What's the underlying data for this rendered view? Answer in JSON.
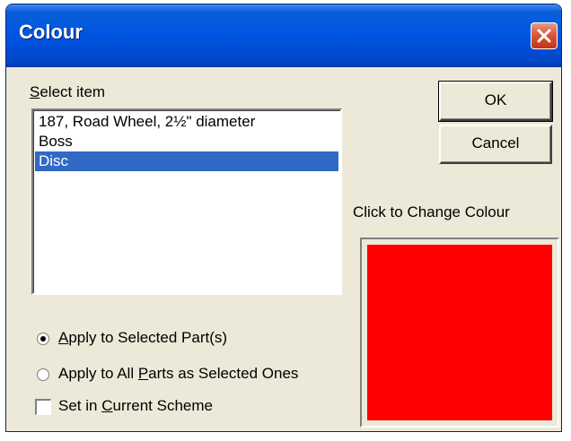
{
  "window": {
    "title": "Colour"
  },
  "select_item": {
    "label_accel": "S",
    "label_rest": "elect item",
    "items": [
      {
        "label": "187, Road Wheel, 2½\" diameter",
        "selected": false
      },
      {
        "label": "Boss",
        "selected": false
      },
      {
        "label": "Disc",
        "selected": true
      }
    ]
  },
  "buttons": {
    "ok": "OK",
    "cancel": "Cancel"
  },
  "colour_panel": {
    "label": "Click to Change Colour",
    "colour": "#ff0000"
  },
  "options": {
    "apply_selected": {
      "pre": "",
      "accel": "A",
      "post": "pply to Selected Part(s)",
      "checked": true
    },
    "apply_all": {
      "pre": "Apply to All ",
      "accel": "P",
      "post": "arts as Selected Ones",
      "checked": false
    },
    "set_scheme": {
      "pre": "Set in ",
      "accel": "C",
      "post": "urrent Scheme",
      "checked": false
    }
  },
  "colors": {
    "selection": "#316ac5",
    "titlebar": "#0054e3",
    "dialog_bg": "#ece9d8"
  }
}
